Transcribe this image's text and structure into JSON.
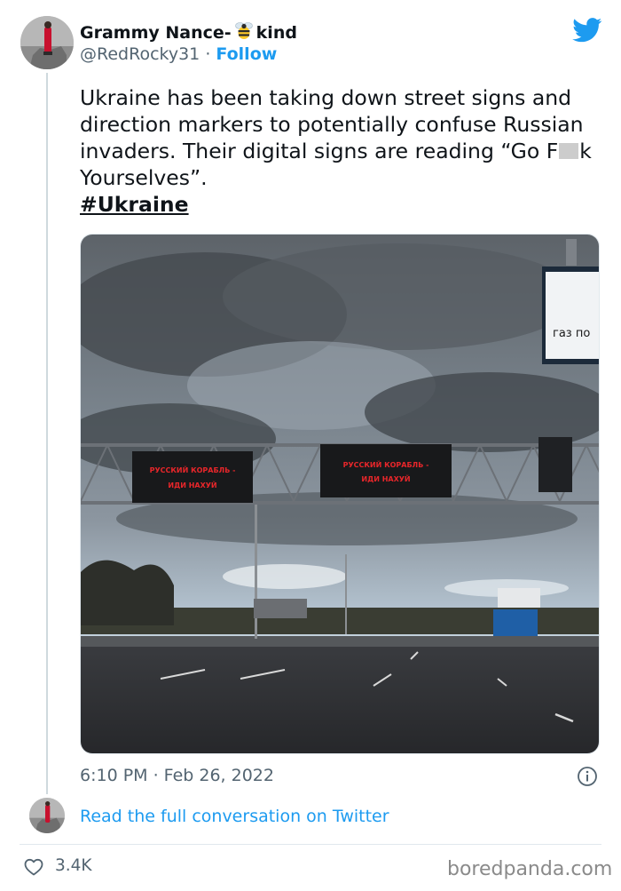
{
  "tweet": {
    "display_name": "Grammy Nance-",
    "display_name_suffix": "kind",
    "display_name_emoji": "bee-icon",
    "handle": "@RedRocky31",
    "separator": "·",
    "follow_label": "Follow",
    "text_part1": "Ukraine has been taking down street signs and direction markers to potentially  confuse Russian invaders. Their digital signs are reading “Go F",
    "text_part2": "k Yourselves”.",
    "hashtag": "#Ukraine",
    "timestamp": "6:10 PM · Feb 26, 2022",
    "read_more_label": "Read the full conversation on Twitter",
    "like_count": "3.4K"
  },
  "photo": {
    "sign_left_line1": "РУССКИЙ КОРАБЛЬ -",
    "sign_left_line2": "ИДИ НАХУЙ",
    "sign_right_line1": "РУССКИЙ КОРАБЛЬ -",
    "sign_right_line2": "ИДИ НАХУЙ",
    "billboard_text": "газ по"
  },
  "footer": {
    "watermark": "boredpanda.com"
  },
  "colors": {
    "accent": "#1d9bf0",
    "text": "#0f1419",
    "muted": "#536471",
    "sign_led": "#e8262a"
  }
}
